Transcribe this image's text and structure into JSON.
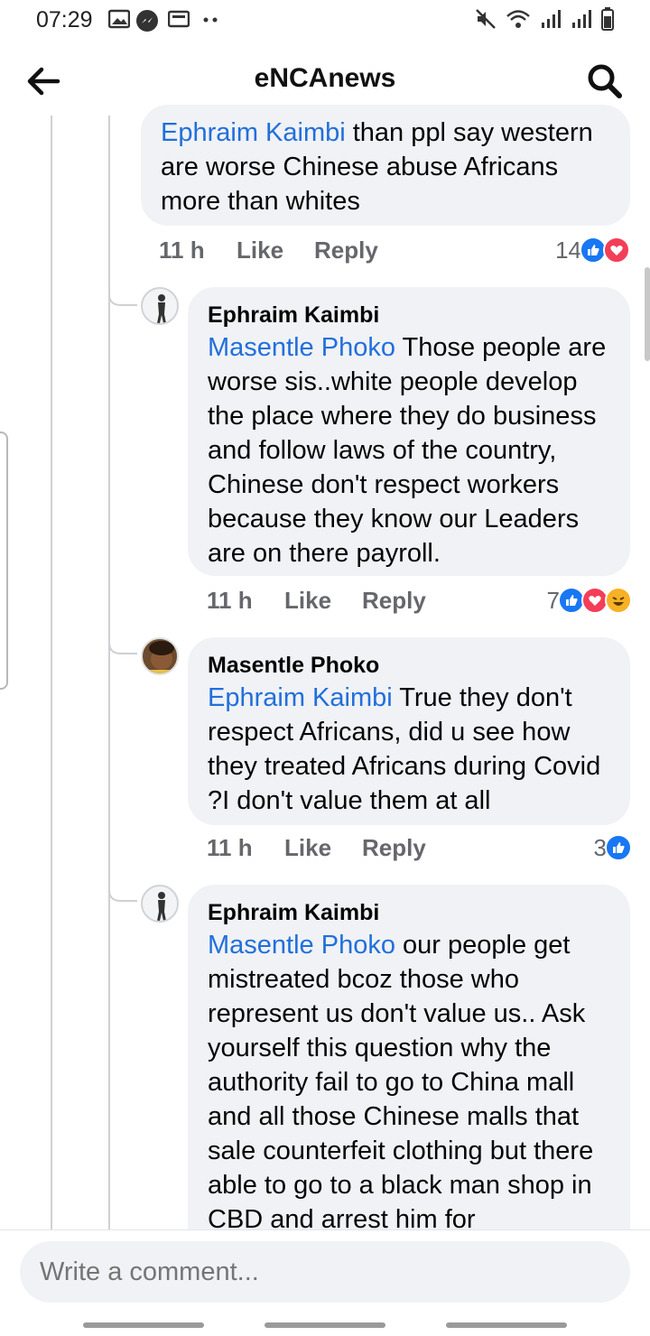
{
  "status_bar": {
    "time": "07:29"
  },
  "header": {
    "title": "eNCAnews"
  },
  "comments": [
    {
      "author": "",
      "mention": "Ephraim Kaimbi",
      "text": " than ppl say western are worse Chinese abuse Africans more than whites",
      "time": "11 h",
      "like": "Like",
      "reply": "Reply",
      "reaction_count": "14",
      "reactions": [
        "like-icon",
        "love-icon"
      ]
    },
    {
      "author": "Ephraim Kaimbi",
      "mention": "Masentle Phoko",
      "text": " Those people are worse sis..white people develop the place where they do business and follow laws of the country, Chinese don't respect workers because they know our Leaders are on there payroll.",
      "time": "11 h",
      "like": "Like",
      "reply": "Reply",
      "reaction_count": "7",
      "reactions": [
        "like-icon",
        "love-icon",
        "haha-icon"
      ]
    },
    {
      "author": "Masentle Phoko",
      "mention": "Ephraim Kaimbi",
      "text": " True they don't respect Africans, did u see how they treated Africans during Covid ?I don't value them at all",
      "time": "11 h",
      "like": "Like",
      "reply": "Reply",
      "reaction_count": "3",
      "reactions": [
        "like-icon"
      ]
    },
    {
      "author": "Ephraim Kaimbi",
      "mention": "Masentle Phoko",
      "text": " our people get mistreated bcoz those who represent us don't value us.. Ask yourself this question why the authority fail to go to China mall and all those Chinese malls that sale counterfeit clothing but there able to go to a black man shop in CBD and arrest him for",
      "time": "",
      "like": "",
      "reply": "",
      "reaction_count": "",
      "reactions": []
    }
  ],
  "compose": {
    "placeholder": "Write a comment..."
  },
  "colors": {
    "mention": "#216fdb",
    "like": "#1877f2",
    "love": "#f33e58",
    "haha": "#f7b125"
  }
}
